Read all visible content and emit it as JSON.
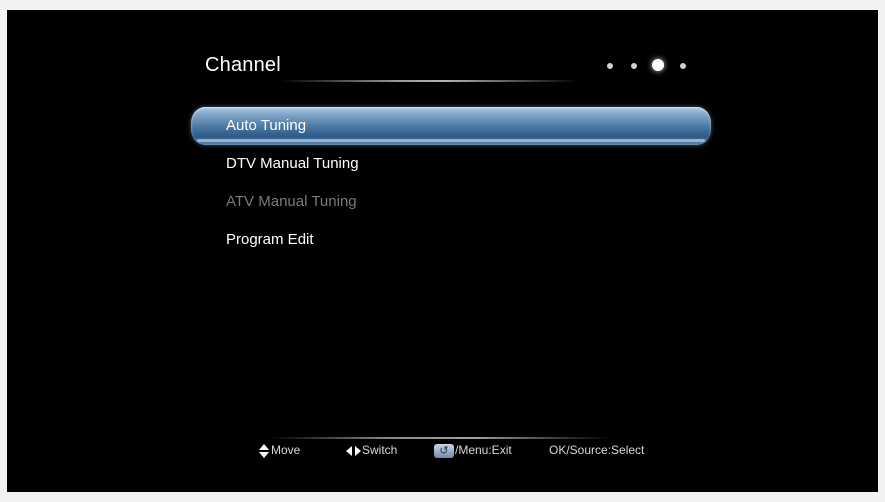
{
  "header": {
    "title": "Channel",
    "page_indicator": {
      "count": 4,
      "active_index": 2
    }
  },
  "menu": {
    "items": [
      {
        "label": "Auto Tuning",
        "state": "selected"
      },
      {
        "label": "DTV Manual Tuning",
        "state": "normal"
      },
      {
        "label": "ATV Manual Tuning",
        "state": "disabled"
      },
      {
        "label": "Program Edit",
        "state": "normal"
      }
    ]
  },
  "footer": {
    "move": {
      "icon": "up-down-arrows-icon",
      "label": "Move"
    },
    "switch": {
      "icon": "left-right-arrows-icon",
      "label": "Switch"
    },
    "exit": {
      "icon": "back-return-icon",
      "label": "/Menu:Exit"
    },
    "select": {
      "label": "OK/Source:Select"
    }
  },
  "colors": {
    "background": "#000000",
    "text": "#ffffff",
    "disabled_text": "#7a7a7a",
    "highlight": "#4e7ba4"
  }
}
